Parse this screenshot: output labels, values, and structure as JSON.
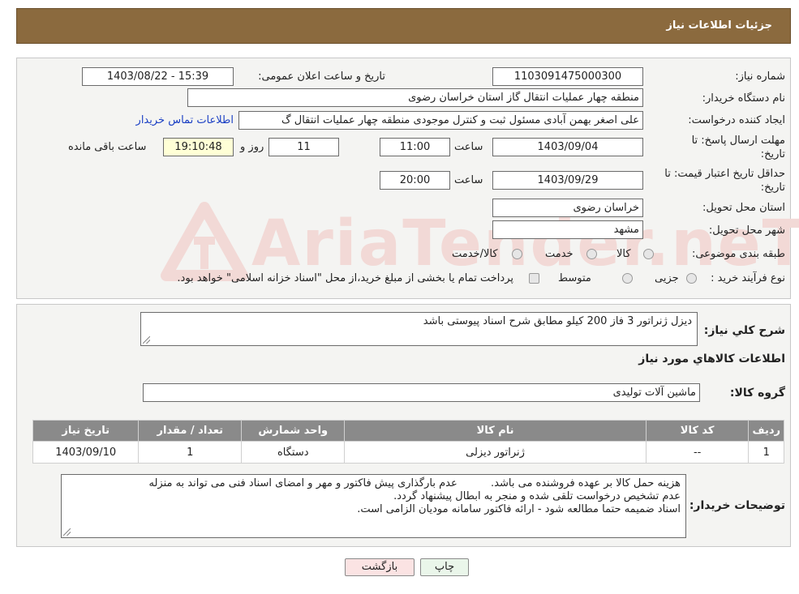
{
  "header": {
    "title": "جزئیات اطلاعات نیاز"
  },
  "fields": {
    "need_number_label": "شماره نیاز:",
    "need_number": "1103091475000300",
    "announce_label": "تاریخ و ساعت اعلان عمومی:",
    "announce_value": "1403/08/22 - 15:39",
    "buyer_org_label": "نام دستگاه خریدار:",
    "buyer_org": "منطقه چهار عملیات انتقال گاز   استان خراسان رضوی",
    "creator_label": "ایجاد کننده درخواست:",
    "creator": "علی اصغر بهمن آبادی مسئول ثبت و کنترل موجودی منطقه چهار عملیات انتقال گ",
    "contact_link": "اطلاعات تماس خریدار",
    "deadline_label_1": "مهلت ارسال پاسخ: تا",
    "deadline_label_2": "تاریخ:",
    "deadline_date": "1403/09/04",
    "time_label": "ساعت",
    "deadline_time": "11:00",
    "days_value": "11",
    "days_label": "روز و",
    "remaining_value": "19:10:48",
    "remaining_label": "ساعت باقی مانده",
    "validity_label_1": "حداقل تاریخ اعتبار قیمت: تا",
    "validity_label_2": "تاریخ:",
    "validity_date": "1403/09/29",
    "validity_time": "20:00",
    "province_label": "استان محل تحویل:",
    "province": "خراسان رضوی",
    "city_label": "شهر محل تحویل:",
    "city": "مشهد",
    "category_label": "طبقه بندی موضوعی:",
    "category_options": [
      "کالا",
      "خدمت",
      "کالا/خدمت"
    ],
    "process_label": "نوع فرآیند خرید :",
    "process_options": [
      "جزیی",
      "متوسط"
    ],
    "process_note": "پرداخت تمام یا بخشی از مبلغ خرید،از محل \"اسناد خزانه اسلامی\" خواهد بود."
  },
  "summary": {
    "label": "شرح کلي نياز:",
    "value": "دیزل ژنراتور 3 فاز 200 کیلو مطابق شرح اسناد پیوستی باشد",
    "goods_info_title": "اطلاعات کالاهاي مورد نياز",
    "group_label": "گروه کالا:",
    "group_value": "ماشین آلات تولیدی"
  },
  "table": {
    "headers": [
      "ردیف",
      "کد کالا",
      "نام کالا",
      "واحد شمارش",
      "تعداد / مقدار",
      "تاریخ نیاز"
    ],
    "rows": [
      [
        "1",
        "--",
        "ژنراتور دیزلی",
        "دستگاه",
        "1",
        "1403/09/10"
      ]
    ]
  },
  "notes": {
    "label": "توضیحات خریدار:",
    "line1": "هزینه حمل کالا بر عهده فروشنده می باشد.          عدم بارگذاری پیش فاکتور و مهر و امضای اسناد فنی می تواند به منزله",
    "line2": "عدم تشخیص درخواست تلقی شده و منجر به ابطال پیشنهاد گردد.",
    "line3": "اسناد ضمیمه حتما مطالعه شود  -  ارائه فاکتور سامانه مودیان الزامی است."
  },
  "buttons": {
    "print": "چاپ",
    "back": "بازگشت"
  },
  "watermark": {
    "text": "AriaTender.neT"
  },
  "colors": {
    "header_bg": "#8b6a3e",
    "link": "#1a3fc4",
    "table_header_bg": "#8a8a8a"
  }
}
